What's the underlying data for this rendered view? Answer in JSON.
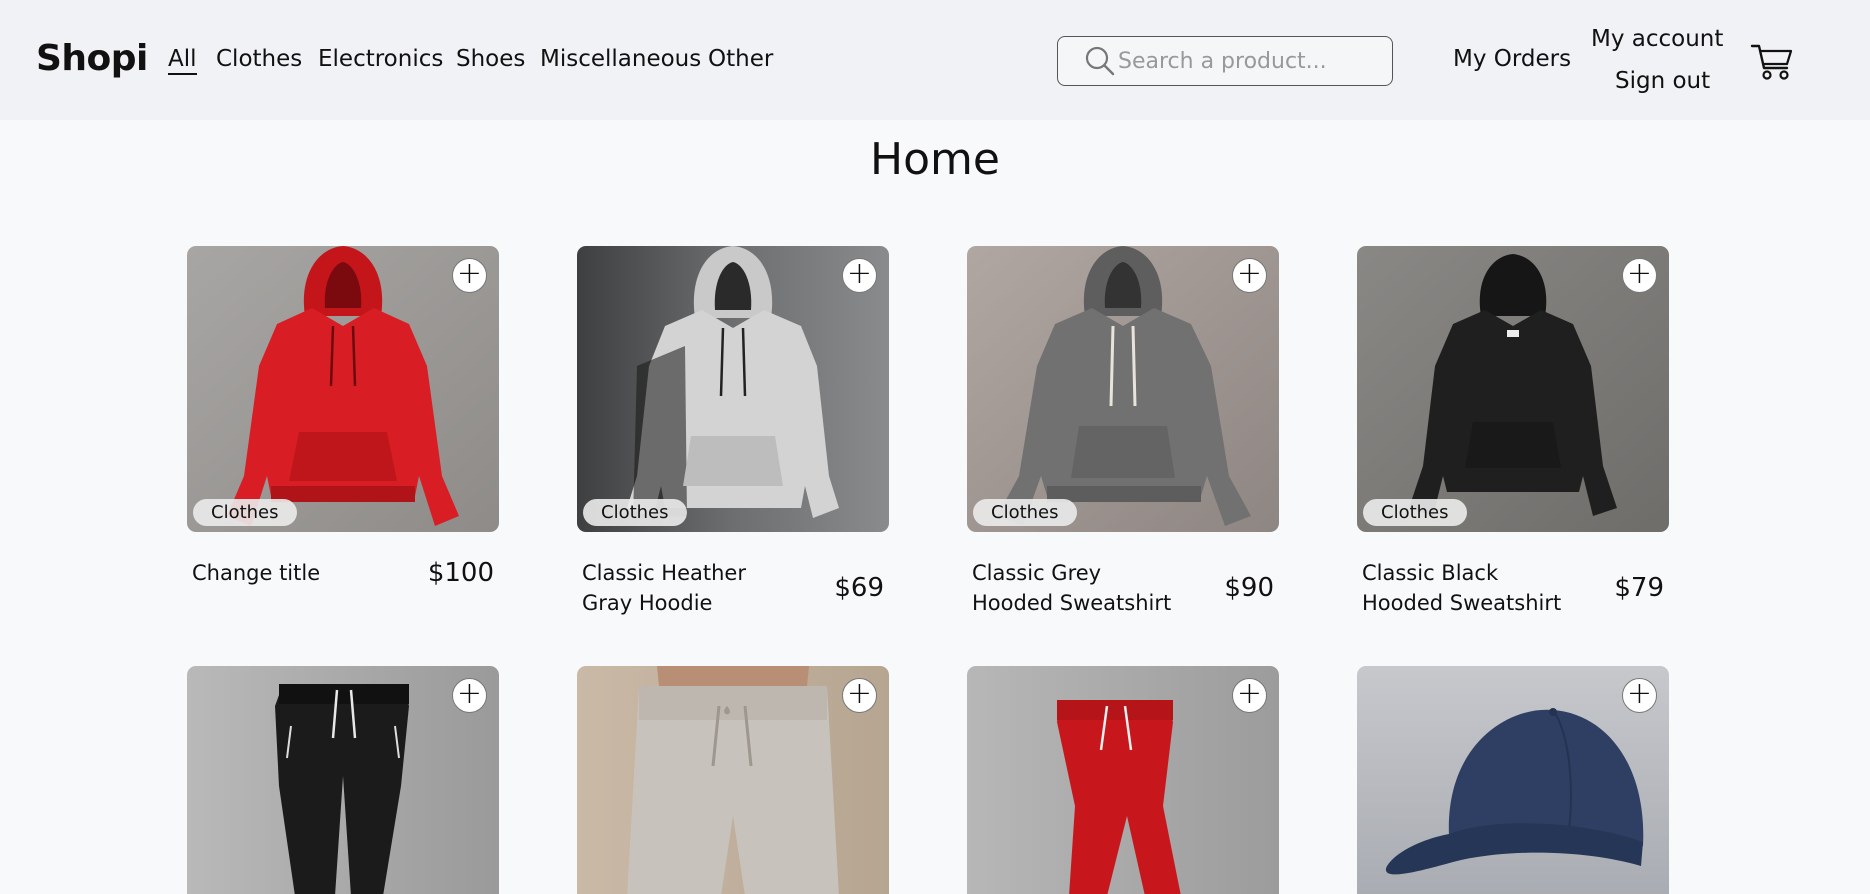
{
  "brand": "Shopi",
  "nav": {
    "categories": [
      "All",
      "Clothes",
      "Electronics",
      "Shoes",
      "Miscellaneous",
      "Other"
    ],
    "active": "All"
  },
  "search": {
    "placeholder": "Search a product...",
    "value": ""
  },
  "account_menu": {
    "orders": "My Orders",
    "account": "My account",
    "signout": "Sign out"
  },
  "page": {
    "title": "Home"
  },
  "icons": {
    "logo": "shopi-wordmark",
    "search": "search-icon",
    "cart": "shopping-cart-icon",
    "add": "plus-icon"
  },
  "colors": {
    "navbar_bg": "#f0f2f5",
    "page_bg": "#f8f9fb",
    "text": "#111111"
  },
  "products": [
    {
      "title": "Change title",
      "price": "$100",
      "category": "Clothes",
      "image": "red hoodie"
    },
    {
      "title": "Classic Heather Gray Hoodie",
      "price": "$69",
      "category": "Clothes",
      "image": "light grey hoodie"
    },
    {
      "title": "Classic Grey Hooded Sweatshirt",
      "price": "$90",
      "category": "Clothes",
      "image": "grey hoodie"
    },
    {
      "title": "Classic Black Hooded Sweatshirt",
      "price": "$79",
      "category": "Clothes",
      "image": "black hoodie"
    },
    {
      "image": "black joggers"
    },
    {
      "image": "beige sweatpants"
    },
    {
      "image": "red joggers"
    },
    {
      "image": "navy baseball cap"
    }
  ]
}
